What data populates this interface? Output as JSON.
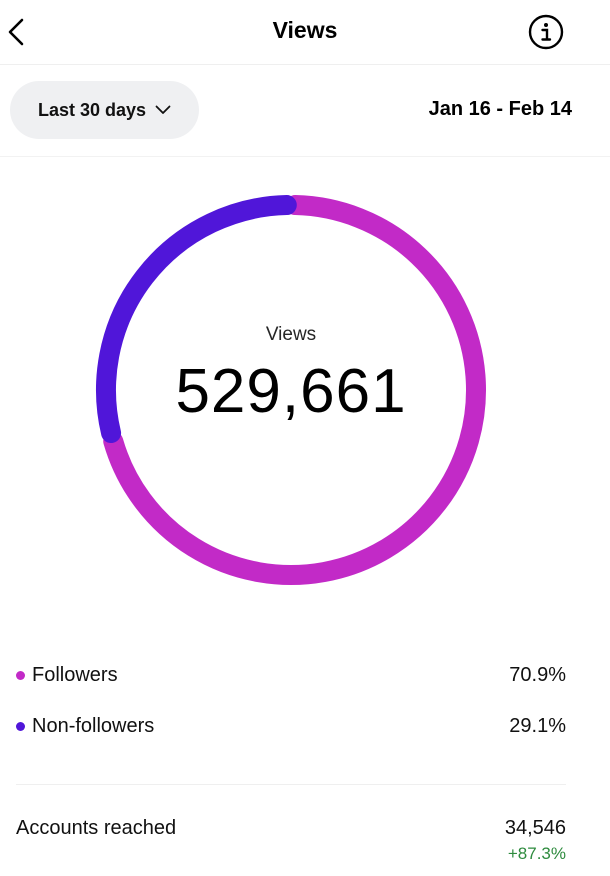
{
  "header": {
    "title": "Views",
    "back_icon": "chevron-left-icon",
    "info_icon": "info-circle-icon"
  },
  "filter": {
    "range_label": "Last 30 days",
    "dropdown_icon": "chevron-down-icon",
    "date_range": "Jan 16 - Feb 14"
  },
  "chart_data": {
    "type": "pie",
    "center_label": "Views",
    "center_value": "529,661",
    "series": [
      {
        "name": "Followers",
        "value": 70.9,
        "label": "70.9%",
        "color": "#c22ac7"
      },
      {
        "name": "Non-followers",
        "value": 29.1,
        "label": "29.1%",
        "color": "#5016d9"
      }
    ]
  },
  "stats": {
    "accounts_reached_label": "Accounts reached",
    "accounts_reached_value": "34,546",
    "accounts_reached_change": "+87.3%",
    "change_color": "#2e8b3e"
  }
}
